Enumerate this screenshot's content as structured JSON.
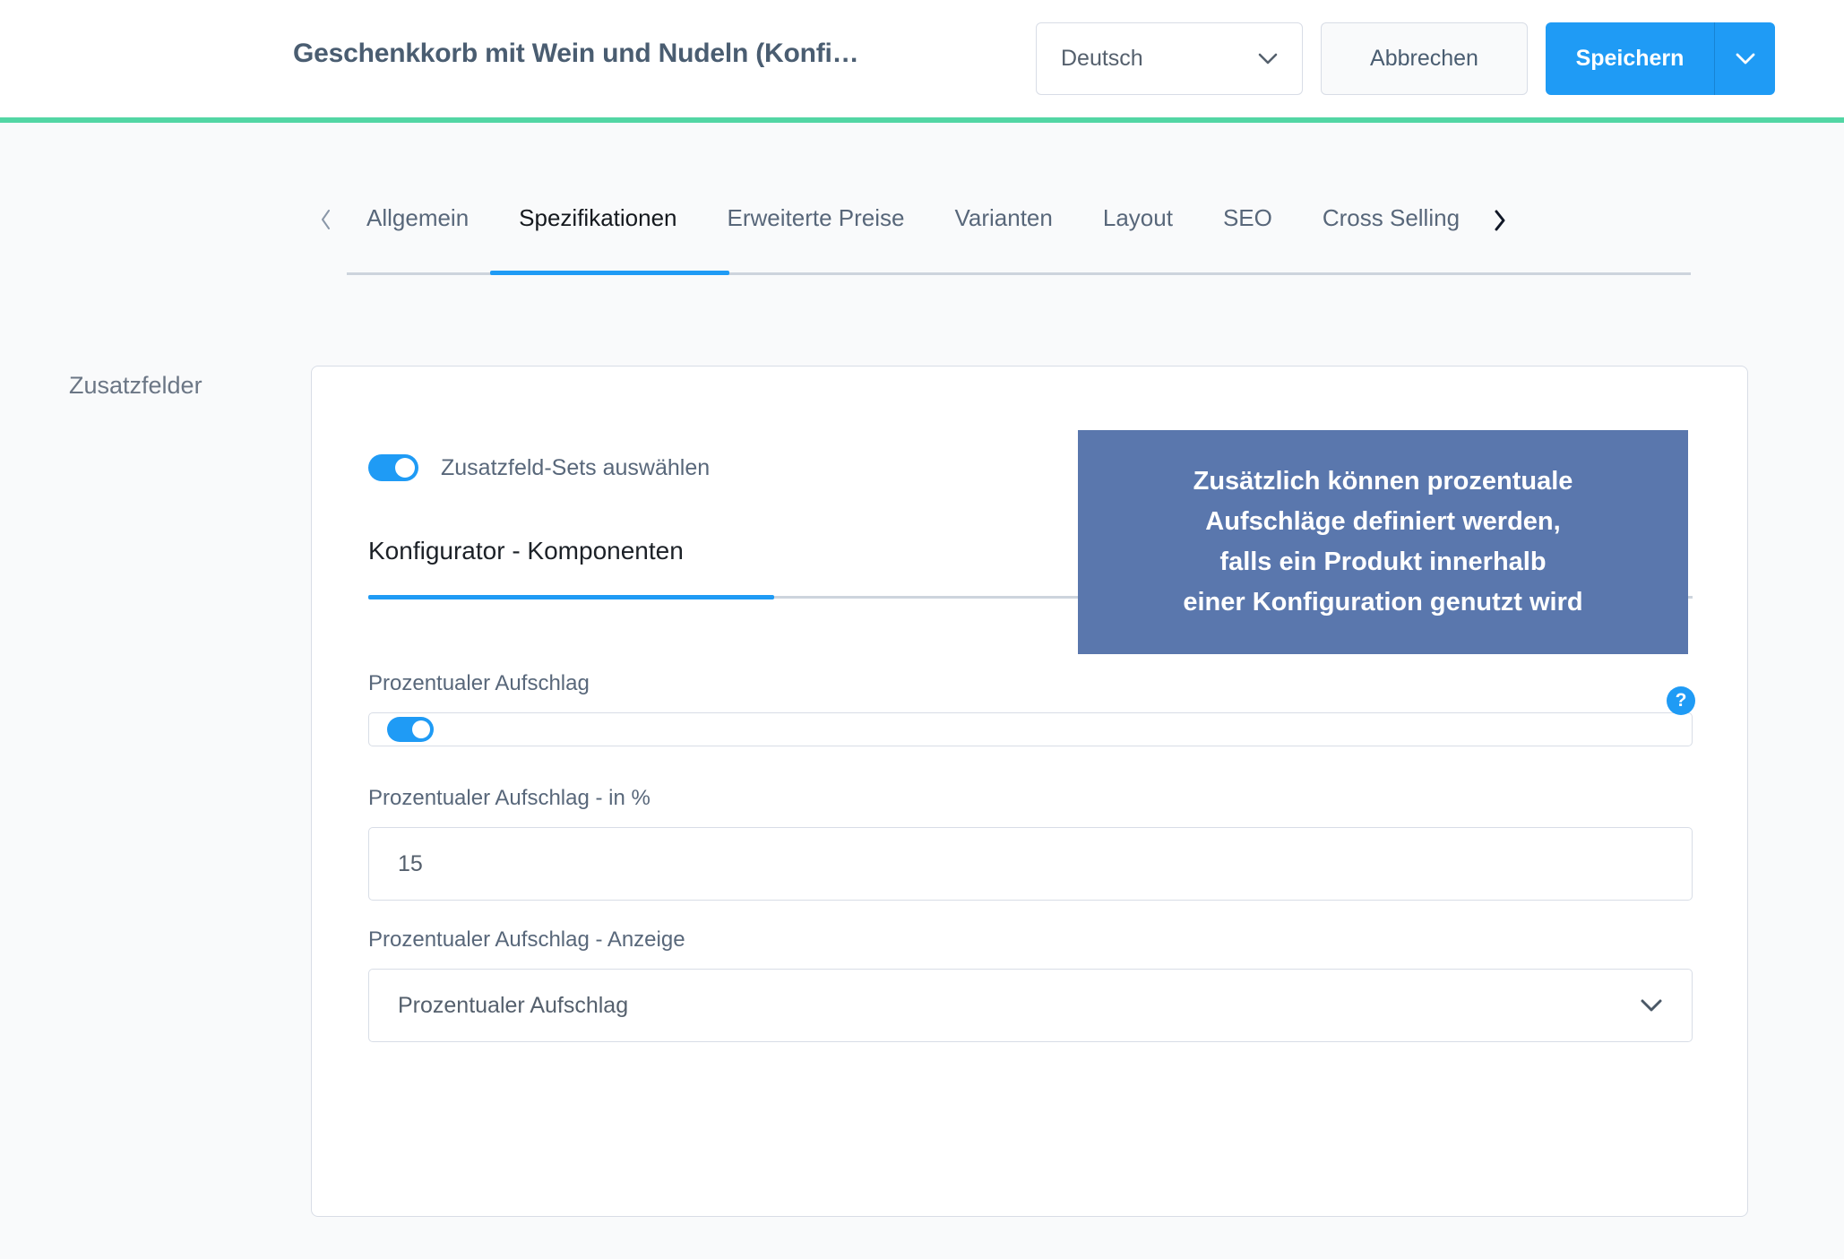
{
  "header": {
    "title": "Geschenkkorb mit Wein und Nudeln (Konfi…",
    "language_label": "Deutsch",
    "cancel_label": "Abbrechen",
    "save_label": "Speichern",
    "language_icon": "chevron-down-icon",
    "save_caret_icon": "chevron-down-icon",
    "accent_color": "#52d6a4",
    "primary_color": "#1f9bf5"
  },
  "tabs": {
    "prev_icon": "chevron-left-icon",
    "next_icon": "chevron-right-icon",
    "items": [
      {
        "label": "Allgemein",
        "active": false
      },
      {
        "label": "Spezifikationen",
        "active": true
      },
      {
        "label": "Erweiterte Preise",
        "active": false
      },
      {
        "label": "Varianten",
        "active": false
      },
      {
        "label": "Layout",
        "active": false
      },
      {
        "label": "SEO",
        "active": false
      },
      {
        "label": "Cross Selling",
        "active": false
      }
    ]
  },
  "section": {
    "label": "Zusatzfelder"
  },
  "card": {
    "sets_toggle_label": "Zusatzfeld-Sets auswählen",
    "sets_toggle_on": true,
    "inner_tab_label": "Konfigurator - Komponenten",
    "help_icon": "help-circle-icon",
    "fields": {
      "surcharge_toggle_label": "Prozentualer Aufschlag",
      "surcharge_toggle_on": true,
      "percent_label": "Prozentualer Aufschlag - in %",
      "percent_value": "15",
      "display_label": "Prozentualer Aufschlag - Anzeige",
      "display_value": "Prozentualer Aufschlag",
      "display_icon": "chevron-down-icon"
    }
  },
  "tooltip": {
    "background": "#5a77ad",
    "lines": [
      "Zusätzlich können prozentuale",
      "Aufschläge definiert werden,",
      "falls ein Produkt innerhalb",
      "einer Konfiguration genutzt wird"
    ]
  }
}
